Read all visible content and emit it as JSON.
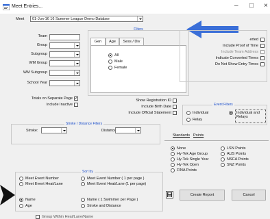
{
  "window": {
    "title": "Meet Entries...",
    "minimize": "–",
    "maximize": "□",
    "close": "×"
  },
  "meet": {
    "label": "Meet",
    "value": "01-Jun-16 16 Summer League Demo Databse"
  },
  "team_fields": [
    {
      "label": "Team"
    },
    {
      "label": "Group"
    },
    {
      "label": "Subgroup"
    },
    {
      "label": "WM Group"
    },
    {
      "label": "WM Subgroup"
    },
    {
      "label": "School Year"
    }
  ],
  "filters": {
    "title": "Filters",
    "tabs": [
      "Gen",
      "Age",
      "Sess / Div"
    ],
    "radios": [
      {
        "label": "All",
        "checked": true
      },
      {
        "label": "Male",
        "checked": false
      },
      {
        "label": "Female",
        "checked": false
      }
    ]
  },
  "left_checks": [
    {
      "label": "Totals on Separate Page",
      "checked": true
    },
    {
      "label": "Include Inactive",
      "checked": false
    }
  ],
  "mid_checks": [
    {
      "label": "Show Registration ID",
      "checked": false
    },
    {
      "label": "Include Birth Date",
      "checked": false
    },
    {
      "label": "Include Official Statement",
      "checked": false
    }
  ],
  "right_options": [
    {
      "label": "erted",
      "checked": false
    },
    {
      "label": "Include Proof of Time",
      "checked": false
    },
    {
      "label": "Include Team Address",
      "checked": false
    },
    {
      "label": "Indicate Converted Times",
      "checked": false
    },
    {
      "label": "Do Not Show Entry Times",
      "checked": false
    }
  ],
  "event_filters": {
    "title": "Event Filters",
    "options": [
      {
        "label": "Individual",
        "checked": false
      },
      {
        "label": "Individual and Relays",
        "checked": true
      },
      {
        "label": "Relay",
        "checked": false
      }
    ]
  },
  "stroke_distance": {
    "title": "Stroke / Distance Filters",
    "stroke_label": "Stroke:",
    "distance_label": "Distance:"
  },
  "standards": {
    "tab1": "Standards",
    "tab2": "Points",
    "options": [
      {
        "label": "None",
        "checked": true
      },
      {
        "label": "LSN Points",
        "checked": false
      },
      {
        "label": "Hy-Tek Age Group",
        "checked": false
      },
      {
        "label": "AUS Points",
        "checked": false
      },
      {
        "label": "Hy-Tek Single Year",
        "checked": false
      },
      {
        "label": "NSCA Points",
        "checked": false
      },
      {
        "label": "Hy-Tek Open",
        "checked": false
      },
      {
        "label": "SNZ Points",
        "checked": false
      },
      {
        "label": "FINA Points",
        "checked": false
      }
    ]
  },
  "sort_by": {
    "title": "Sort by",
    "options": [
      {
        "label": "Meet Event Number",
        "checked": false
      },
      {
        "label": "Meet Event Number ( 1 per page )",
        "checked": false
      },
      {
        "label": "Meet Event Heat/Lane",
        "checked": false
      },
      {
        "label": "Meet Event Heat/Lane (1 per page)",
        "checked": false
      },
      {
        "label": "Name",
        "checked": true
      },
      {
        "label": "Name ( 1 Swimmer per Page )",
        "checked": false
      },
      {
        "label": "Age",
        "checked": false
      },
      {
        "label": "Stroke and Distance",
        "checked": false
      }
    ]
  },
  "bottom_partial": "Group Within Heat/Lane/Name",
  "buttons": {
    "create_report": "Create Report",
    "cancel": "Cancel"
  }
}
